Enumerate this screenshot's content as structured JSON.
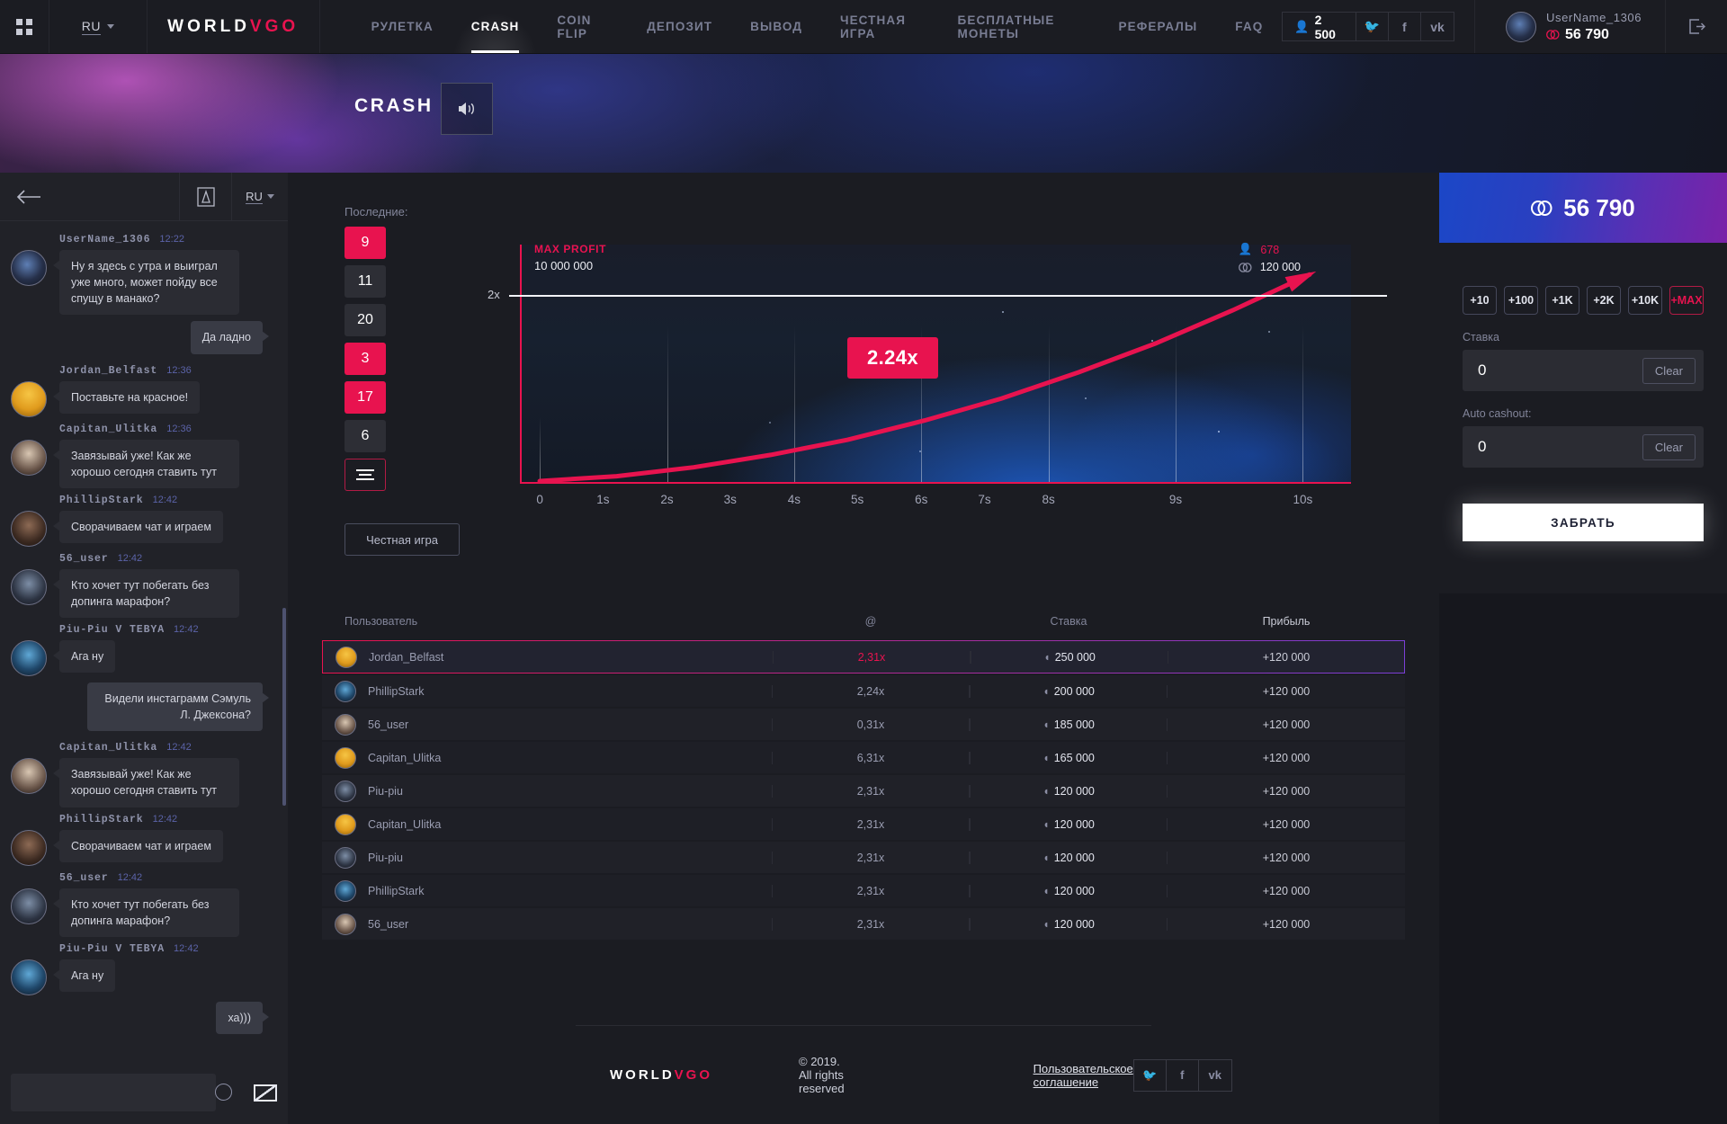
{
  "topbar": {
    "grid_icon": "apps-grid-icon",
    "language": "RU",
    "logo_world": "WORLD",
    "logo_vgo": "VGO",
    "nav": [
      {
        "label": "РУЛЕТКА",
        "active": false
      },
      {
        "label": "CRASH",
        "active": true
      },
      {
        "label": "COIN FLIP",
        "active": false
      },
      {
        "label": "ДЕПОЗИТ",
        "active": false
      },
      {
        "label": "ВЫВОД",
        "active": false
      },
      {
        "label": "ЧЕСТНАЯ ИГРА",
        "active": false
      },
      {
        "label": "БЕСПЛАТНЫЕ МОНЕТЫ",
        "active": false
      },
      {
        "label": "РЕФЕРАЛЫ",
        "active": false
      },
      {
        "label": "FAQ",
        "active": false
      }
    ],
    "online_count": "2 500",
    "social": [
      "twitter-icon",
      "facebook-icon",
      "vk-icon"
    ],
    "user_name": "UserName_1306",
    "user_balance": "56 790",
    "logout_icon": "logout-icon"
  },
  "hero": {
    "title": "CRASH",
    "sound_icon": "speaker-on-icon"
  },
  "chat": {
    "back_icon": "arrow-left-icon",
    "font_icon": "font-size-icon",
    "language": "RU",
    "input_placeholder": "",
    "input_value": "",
    "emoji_icon": "emoji-icon",
    "send_icon": "send-envelope-icon",
    "messages": [
      {
        "own": false,
        "user": "UserName_1306",
        "time": "12:22",
        "text": "Ну я здесь с утра и выиграл уже много, может пойду все спущу в манако?",
        "avatar": "av-a"
      },
      {
        "own": true,
        "user": "",
        "time": "",
        "text": "Да ладно",
        "avatar": ""
      },
      {
        "own": false,
        "user": "Jordan_Belfast",
        "time": "12:36",
        "text": "Поставьте на красное!",
        "avatar": "av-c"
      },
      {
        "own": false,
        "user": "Capitan_Ulitka",
        "time": "12:36",
        "text": "Завязывай уже! Как же хорошо сегодня ставить тут",
        "avatar": "av-e"
      },
      {
        "own": false,
        "user": "PhillipStark",
        "time": "12:42",
        "text": "Сворачиваем чат и играем",
        "avatar": "av-d"
      },
      {
        "own": false,
        "user": "56_user",
        "time": "12:42",
        "text": "Кто хочет тут  побегать без допинга марафон?",
        "avatar": "av-b"
      },
      {
        "own": false,
        "user": "Piu-Piu V TEBYA",
        "time": "12:42",
        "text": "Ага ну",
        "avatar": "av-f"
      },
      {
        "own": true,
        "user": "",
        "time": "",
        "text": "Видели инстаграмм Сэмуль Л. Джексона?",
        "avatar": ""
      },
      {
        "own": false,
        "user": "Capitan_Ulitka",
        "time": "12:42",
        "text": "Завязывай уже! Как же хорошо сегодня ставить тут",
        "avatar": "av-e"
      },
      {
        "own": false,
        "user": "PhillipStark",
        "time": "12:42",
        "text": "Сворачиваем чат и играем",
        "avatar": "av-d"
      },
      {
        "own": false,
        "user": "56_user",
        "time": "12:42",
        "text": "Кто хочет тут  побегать без допинга марафон?",
        "avatar": "av-b"
      },
      {
        "own": false,
        "user": "Piu-Piu V TEBYA",
        "time": "12:42",
        "text": "Ага ну",
        "avatar": "av-f"
      },
      {
        "own": true,
        "user": "",
        "time": "",
        "text": "ха)))",
        "avatar": ""
      }
    ]
  },
  "game": {
    "last_label": "Последние:",
    "last_results": [
      {
        "value": "9",
        "hot": true
      },
      {
        "value": "11",
        "hot": false
      },
      {
        "value": "20",
        "hot": false
      },
      {
        "value": "3",
        "hot": true
      },
      {
        "value": "17",
        "hot": true
      },
      {
        "value": "6",
        "hot": false
      }
    ],
    "history_icon": "history-list-icon",
    "fair_game_button": "Честная игра"
  },
  "chart_data": {
    "type": "line",
    "title": "",
    "max_profit_label": "MAX PROFIT",
    "max_profit_value": "10 000 000",
    "players_count": "678",
    "players_icon": "player-icon",
    "pot_value": "120 000",
    "pot_icon": "coin-icon",
    "current_multiplier": "2.24x",
    "ylabel": "",
    "xlabel": "",
    "y_ticks": [
      "2x"
    ],
    "y_tick_values": [
      2
    ],
    "categories": [
      "0",
      "1s",
      "2s",
      "3s",
      "4s",
      "5s",
      "6s",
      "7s",
      "8s",
      "9s",
      "10s"
    ],
    "x": [
      0,
      1,
      2,
      3,
      4,
      5,
      6,
      7,
      8,
      9,
      10
    ],
    "values": [
      1.0,
      1.07,
      1.2,
      1.38,
      1.6,
      1.88,
      2.2,
      2.58,
      3.0,
      3.48,
      4.0
    ],
    "ylim": [
      1,
      4.2
    ],
    "xlim": [
      0,
      10
    ],
    "grid": false,
    "series_color": "#e8134f",
    "legend": "none"
  },
  "bets": {
    "columns": {
      "user": "Пользователь",
      "mult": "@",
      "bet": "Ставка",
      "profit": "Прибыль"
    },
    "rows": [
      {
        "user": "Jordan_Belfast",
        "mult": "2,31x",
        "bet": "250 000",
        "profit": "+120 000",
        "avatar": "av-c",
        "highlight": true
      },
      {
        "user": "PhillipStark",
        "mult": "2,24x",
        "bet": "200 000",
        "profit": "+120 000",
        "avatar": "av-f",
        "highlight": false
      },
      {
        "user": "56_user",
        "mult": "0,31x",
        "bet": "185 000",
        "profit": "+120 000",
        "avatar": "av-e",
        "highlight": false
      },
      {
        "user": "Capitan_Ulitka",
        "mult": "6,31x",
        "bet": "165 000",
        "profit": "+120 000",
        "avatar": "av-c",
        "highlight": false
      },
      {
        "user": "Piu-piu",
        "mult": "2,31x",
        "bet": "120 000",
        "profit": "+120 000",
        "avatar": "av-b",
        "highlight": false
      },
      {
        "user": "Capitan_Ulitka",
        "mult": "2,31x",
        "bet": "120 000",
        "profit": "+120 000",
        "avatar": "av-c",
        "highlight": false
      },
      {
        "user": "Piu-piu",
        "mult": "2,31x",
        "bet": "120 000",
        "profit": "+120 000",
        "avatar": "av-b",
        "highlight": false
      },
      {
        "user": "PhillipStark",
        "mult": "2,31x",
        "bet": "120 000",
        "profit": "+120 000",
        "avatar": "av-f",
        "highlight": false
      },
      {
        "user": "56_user",
        "mult": "2,31x",
        "bet": "120 000",
        "profit": "+120 000",
        "avatar": "av-e",
        "highlight": false
      }
    ]
  },
  "panel": {
    "balance": "56 790",
    "balance_icon": "coin-icon",
    "quick_amounts": [
      {
        "label": "+10",
        "max": false
      },
      {
        "label": "+100",
        "max": false
      },
      {
        "label": "+1K",
        "max": false
      },
      {
        "label": "+2K",
        "max": false
      },
      {
        "label": "+10K",
        "max": false
      },
      {
        "label": "+MAX",
        "max": true
      }
    ],
    "bet_label": "Ставка",
    "bet_value": "0",
    "bet_clear": "Clear",
    "auto_label": "Auto cashout:",
    "auto_value": "0",
    "auto_clear": "Clear",
    "take_button": "ЗАБРАТЬ"
  },
  "footer": {
    "logo_world": "WORLD",
    "logo_vgo": "VGO",
    "copyright": "© 2019. All rights reserved",
    "agreement": "Пользовательское соглашение",
    "social": [
      "twitter-icon",
      "facebook-icon",
      "vk-icon"
    ]
  }
}
